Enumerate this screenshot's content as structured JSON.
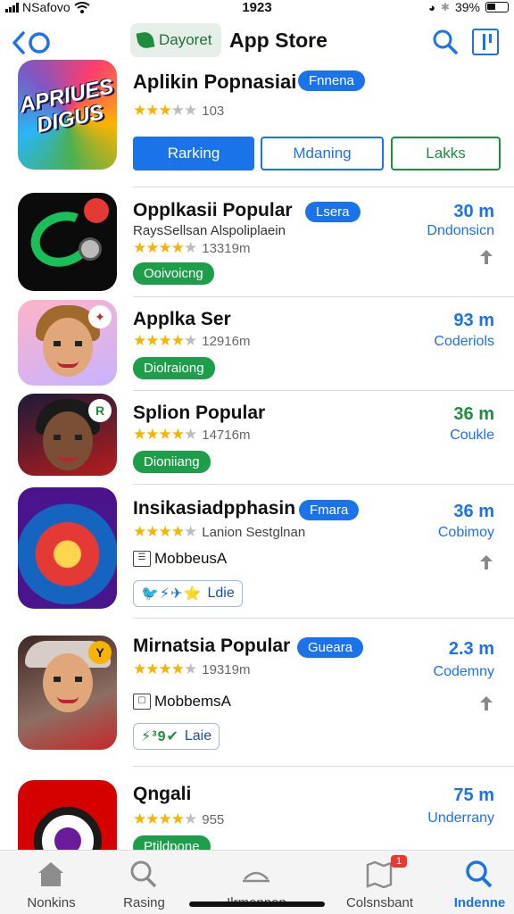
{
  "status": {
    "carrier": "NSafovo",
    "time": "1923",
    "battery": "39%"
  },
  "header": {
    "pill_label": "Dayoret",
    "title": "App Store"
  },
  "hero": {
    "icon_word": "APRIUES DIGUS",
    "name": "Aplikin Popnasiai",
    "badge": "Fnnena",
    "rating_count": "103",
    "stars": 3,
    "segments": [
      "Rarking",
      "Mdaning",
      "Lakks"
    ]
  },
  "apps": [
    {
      "name": "Opplkasii Popular",
      "badge": "Lsera",
      "subtitle": "RaysSellsan Alspoliplaein",
      "stars": 4,
      "rating_count": "13319m",
      "status_pill": "Ooivoicng",
      "size": "30 m",
      "dev": "Dndonsicn"
    },
    {
      "name": "Applka Ser",
      "stars": 4,
      "rating_count": "12916m",
      "status_pill": "Diolraiong",
      "size": "93 m",
      "dev": "Coderiols"
    },
    {
      "name": "Splion Popular",
      "stars": 4,
      "rating_count": "14716m",
      "status_pill": "Dioniiang",
      "size": "36 m",
      "dev": "Coukle"
    },
    {
      "name": "Insikasiadpphasin",
      "badge": "Fmara",
      "stars": 4,
      "rating_text": "Lanion Sestglnan",
      "book_label": "MobbeusA",
      "chip_label": "Ldie",
      "chip_icons": "🐦⚡✈⭐",
      "size": "36 m",
      "dev": "Cobimoy"
    },
    {
      "name": "Mirnatsia Popular",
      "badge": "Gueara",
      "stars": 4,
      "rating_count": "19319m",
      "book_label": "MobbemsA",
      "chip_label": "Laie",
      "chip_icons": "⚡³9✔",
      "size": "2.3 m",
      "dev": "Codemny",
      "corner": "Y"
    },
    {
      "name": "Qngali",
      "stars": 4,
      "rating_count": "955",
      "status_pill": "Ptildpone",
      "size": "75 m",
      "dev": "Underrany"
    }
  ],
  "tabs": [
    {
      "label": "Nonkins",
      "icon": "home-icon"
    },
    {
      "label": "Rasing",
      "icon": "search-icon"
    },
    {
      "label": "Ilrmonnon",
      "icon": "hat-icon"
    },
    {
      "label": "Colsnsbant",
      "icon": "map-icon",
      "badge": "1"
    },
    {
      "label": "Indenne",
      "icon": "search-icon",
      "active": true
    }
  ],
  "colors": {
    "accent": "#1a73e8",
    "green": "#1e8e3e",
    "star": "#f6b400"
  }
}
